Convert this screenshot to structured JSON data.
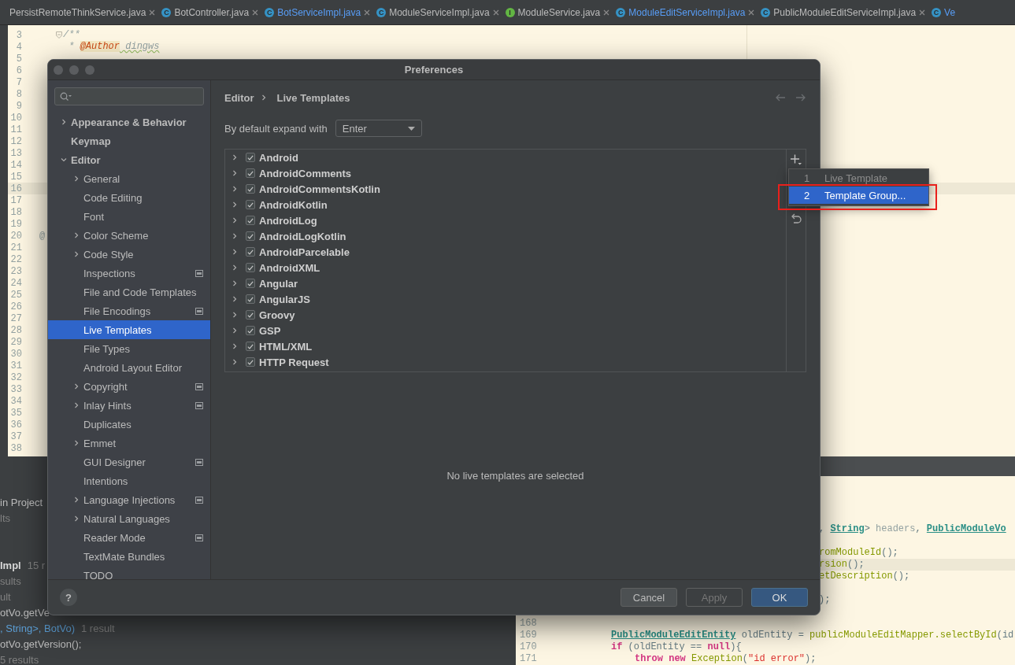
{
  "tabs": [
    {
      "label": "PersistRemoteThinkService.java",
      "modified": false,
      "cut": false
    },
    {
      "badge": "C",
      "kind": "class",
      "label": "BotController.java",
      "modified": false,
      "cut": false
    },
    {
      "badge": "C",
      "kind": "class",
      "label": "BotServiceImpl.java",
      "modified": true,
      "cut": false
    },
    {
      "badge": "C",
      "kind": "class",
      "label": "ModuleServiceImpl.java",
      "modified": false,
      "cut": false
    },
    {
      "badge": "I",
      "kind": "interface",
      "label": "ModuleService.java",
      "modified": false,
      "cut": false
    },
    {
      "badge": "C",
      "kind": "class",
      "label": "ModuleEditServiceImpl.java",
      "modified": true,
      "cut": false
    },
    {
      "badge": "C",
      "kind": "class",
      "label": "PublicModuleEditServiceImpl.java",
      "modified": false,
      "cut": false
    },
    {
      "badge": "C",
      "kind": "class",
      "label": "Ve",
      "modified": true,
      "cut": true
    }
  ],
  "editor": {
    "lines": [
      {
        "number": "3",
        "current": false,
        "foldable": true,
        "code": [
          {
            "kind": "comment",
            "text": "/**"
          }
        ]
      },
      {
        "number": "4",
        "current": false,
        "code": [
          {
            "kind": "comment",
            "text": " * "
          },
          {
            "kind": "tag",
            "text": "@Author"
          },
          {
            "kind": "doc",
            "text": " dingws"
          }
        ]
      },
      {
        "number": "5",
        "current": false
      },
      {
        "number": "6",
        "current": false
      },
      {
        "number": "7",
        "current": false
      },
      {
        "number": "8",
        "current": false
      },
      {
        "number": "9",
        "current": false
      },
      {
        "number": "10",
        "current": false
      },
      {
        "number": "11",
        "current": false
      },
      {
        "number": "12",
        "current": false
      },
      {
        "number": "13",
        "current": false
      },
      {
        "number": "14",
        "current": false
      },
      {
        "number": "15",
        "current": false
      },
      {
        "number": "16",
        "current": true
      },
      {
        "number": "17",
        "current": false
      },
      {
        "number": "18",
        "current": false
      },
      {
        "number": "19",
        "current": false
      },
      {
        "number": "20",
        "current": false,
        "gutter_mark": "@"
      },
      {
        "number": "21",
        "current": false
      },
      {
        "number": "22",
        "current": false
      },
      {
        "number": "23",
        "current": false
      },
      {
        "number": "24",
        "current": false
      },
      {
        "number": "25",
        "current": false
      },
      {
        "number": "26",
        "current": false
      },
      {
        "number": "27",
        "current": false
      },
      {
        "number": "28",
        "current": false
      },
      {
        "number": "29",
        "current": false
      },
      {
        "number": "30",
        "current": false
      },
      {
        "number": "31",
        "current": false
      },
      {
        "number": "32",
        "current": false
      },
      {
        "number": "33",
        "current": false
      },
      {
        "number": "34",
        "current": false
      },
      {
        "number": "35",
        "current": false
      },
      {
        "number": "36",
        "current": false
      },
      {
        "number": "37",
        "current": false
      },
      {
        "number": "38",
        "current": false
      }
    ]
  },
  "find_results": {
    "groups": [
      [
        {
          "segments": [
            {
              "kind": "normal",
              "text": "in Project"
            }
          ]
        },
        {
          "segments": [
            {
              "kind": "dim",
              "text": "lts"
            }
          ]
        }
      ],
      [
        {
          "segments": [
            {
              "kind": "bold",
              "text": "Impl"
            },
            {
              "kind": "dim",
              "text": "15 r"
            }
          ]
        },
        {
          "segments": [
            {
              "kind": "dim",
              "text": "sults"
            }
          ]
        },
        {
          "segments": [
            {
              "kind": "dim",
              "text": "ult"
            }
          ]
        },
        {
          "segments": [
            {
              "kind": "normal",
              "text": "otVo.getVe"
            }
          ]
        },
        {
          "segments": [
            {
              "kind": "link",
              "text": ", String>, BotVo)"
            },
            {
              "kind": "dim",
              "text": "1 result"
            }
          ]
        },
        {
          "segments": [
            {
              "kind": "normal",
              "text": "otVo.getVersion();"
            }
          ]
        },
        {
          "segments": [
            {
              "kind": "dim",
              "text": "5 results"
            }
          ]
        }
      ]
    ]
  },
  "lower_editor": {
    "lines": [
      {
        "current": false
      },
      {
        "current": false
      },
      {
        "current": false
      },
      {
        "current": false
      },
      {
        "kind": "fragment",
        "current": false,
        "code": [
          {
            "kind": "plain",
            "text": ", "
          },
          {
            "kind": "type",
            "text": "String"
          },
          {
            "kind": "plain",
            "text": "> "
          },
          {
            "kind": "param",
            "text": "headers"
          },
          {
            "kind": "plain",
            "text": ", "
          },
          {
            "kind": "type",
            "text": "PublicModuleVo"
          }
        ]
      },
      {
        "current": false
      },
      {
        "kind": "fragment",
        "current": false,
        "code": [
          {
            "kind": "method",
            "text": "romModuleId"
          },
          {
            "kind": "plain",
            "text": "();"
          }
        ]
      },
      {
        "kind": "fragment",
        "current": true,
        "code": [
          {
            "kind": "method",
            "text": "rsion"
          },
          {
            "kind": "plain",
            "text": "();"
          }
        ]
      },
      {
        "kind": "fragment",
        "current": false,
        "code": [
          {
            "kind": "method",
            "text": "etDescription"
          },
          {
            "kind": "plain",
            "text": "();"
          }
        ]
      },
      {
        "current": false
      },
      {
        "kind": "fragment",
        "current": false,
        "code": [
          {
            "kind": "plain",
            "text": ");"
          }
        ]
      },
      {
        "current": false
      },
      {
        "current": false,
        "number": "168"
      },
      {
        "kind": "statement",
        "current": false,
        "number": "169",
        "code": [
          {
            "kind": "type",
            "text": "PublicModuleEditEntity"
          },
          {
            "kind": "plain",
            "text": " oldEntity = "
          },
          {
            "kind": "method",
            "text": "publicModuleEditMapper.selectById"
          },
          {
            "kind": "plain",
            "text": "(id"
          }
        ]
      },
      {
        "kind": "statement",
        "current": false,
        "number": "170",
        "code": [
          {
            "kind": "keyword",
            "text": "if"
          },
          {
            "kind": "plain",
            "text": " (oldEntity == "
          },
          {
            "kind": "keyword",
            "text": "null"
          },
          {
            "kind": "plain",
            "text": "){"
          }
        ]
      },
      {
        "kind": "nested",
        "current": false,
        "number": "171",
        "code": [
          {
            "kind": "keyword",
            "text": "throw"
          },
          {
            "kind": "keyword",
            "text": " new"
          },
          {
            "kind": "method",
            "text": " Exception"
          },
          {
            "kind": "plain",
            "text": "("
          },
          {
            "kind": "string",
            "text": "\"id error\""
          },
          {
            "kind": "plain",
            "text": ");"
          }
        ]
      }
    ]
  },
  "dialog": {
    "title": "Preferences",
    "sidebar": {
      "items": [
        {
          "label": "Appearance & Behavior",
          "kind": "group",
          "expanded": false,
          "selected": false,
          "project_level": false
        },
        {
          "label": "Keymap",
          "kind": "page",
          "selected": false,
          "project_level": false
        },
        {
          "label": "Editor",
          "kind": "group",
          "expanded": true,
          "selected": false,
          "project_level": false,
          "children": [
            {
              "label": "General",
              "kind": "group",
              "expanded": false,
              "selected": false,
              "project_level": false
            },
            {
              "label": "Code Editing",
              "kind": "page",
              "selected": false,
              "project_level": false
            },
            {
              "label": "Font",
              "kind": "page",
              "selected": false,
              "project_level": false
            },
            {
              "label": "Color Scheme",
              "kind": "group",
              "expanded": false,
              "selected": false,
              "project_level": false
            },
            {
              "label": "Code Style",
              "kind": "group",
              "expanded": false,
              "selected": false,
              "project_level": false
            },
            {
              "label": "Inspections",
              "kind": "page",
              "selected": false,
              "project_level": true
            },
            {
              "label": "File and Code Templates",
              "kind": "page",
              "selected": false,
              "project_level": false
            },
            {
              "label": "File Encodings",
              "kind": "page",
              "selected": false,
              "project_level": true
            },
            {
              "label": "Live Templates",
              "kind": "page",
              "selected": true,
              "project_level": false
            },
            {
              "label": "File Types",
              "kind": "page",
              "selected": false,
              "project_level": false
            },
            {
              "label": "Android Layout Editor",
              "kind": "page",
              "selected": false,
              "project_level": false
            },
            {
              "label": "Copyright",
              "kind": "group",
              "expanded": false,
              "selected": false,
              "project_level": true
            },
            {
              "label": "Inlay Hints",
              "kind": "group",
              "expanded": false,
              "selected": false,
              "project_level": true
            },
            {
              "label": "Duplicates",
              "kind": "page",
              "selected": false,
              "project_level": false
            },
            {
              "label": "Emmet",
              "kind": "group",
              "expanded": false,
              "selected": false,
              "project_level": false
            },
            {
              "label": "GUI Designer",
              "kind": "page",
              "selected": false,
              "project_level": true
            },
            {
              "label": "Intentions",
              "kind": "page",
              "selected": false,
              "project_level": false
            },
            {
              "label": "Language Injections",
              "kind": "group",
              "expanded": false,
              "selected": false,
              "project_level": true
            },
            {
              "label": "Natural Languages",
              "kind": "group",
              "expanded": false,
              "selected": false,
              "project_level": false
            },
            {
              "label": "Reader Mode",
              "kind": "page",
              "selected": false,
              "project_level": true
            },
            {
              "label": "TextMate Bundles",
              "kind": "page",
              "selected": false,
              "project_level": false
            },
            {
              "label": "TODO",
              "kind": "page",
              "selected": false,
              "project_level": false
            }
          ]
        }
      ]
    },
    "breadcrumb": [
      "Editor",
      "Live Templates"
    ],
    "expand_with": {
      "label": "By default expand with",
      "value": "Enter"
    },
    "template_groups": [
      {
        "label": "Android",
        "checked": true,
        "expanded": false
      },
      {
        "label": "AndroidComments",
        "checked": true,
        "expanded": false
      },
      {
        "label": "AndroidCommentsKotlin",
        "checked": true,
        "expanded": false
      },
      {
        "label": "AndroidKotlin",
        "checked": true,
        "expanded": false
      },
      {
        "label": "AndroidLog",
        "checked": true,
        "expanded": false
      },
      {
        "label": "AndroidLogKotlin",
        "checked": true,
        "expanded": false
      },
      {
        "label": "AndroidParcelable",
        "checked": true,
        "expanded": false
      },
      {
        "label": "AndroidXML",
        "checked": true,
        "expanded": false
      },
      {
        "label": "Angular",
        "checked": true,
        "expanded": false
      },
      {
        "label": "AngularJS",
        "checked": true,
        "expanded": false
      },
      {
        "label": "Groovy",
        "checked": true,
        "expanded": false
      },
      {
        "label": "GSP",
        "checked": true,
        "expanded": false
      },
      {
        "label": "HTML/XML",
        "checked": true,
        "expanded": false
      },
      {
        "label": "HTTP Request",
        "checked": true,
        "expanded": false
      }
    ],
    "empty_message": "No live templates are selected",
    "help": "?",
    "buttons": [
      {
        "label": "Cancel",
        "kind": "normal",
        "disabled": false
      },
      {
        "label": "Apply",
        "kind": "normal",
        "disabled": true
      },
      {
        "label": "OK",
        "kind": "default",
        "disabled": false
      }
    ]
  },
  "add_menu": {
    "items": [
      {
        "mnemonic": "1",
        "label": "Live Template",
        "disabled": true,
        "selected": false,
        "annotated": false
      },
      {
        "mnemonic": "2",
        "label": "Template Group...",
        "disabled": false,
        "selected": true,
        "annotated": true
      }
    ]
  }
}
